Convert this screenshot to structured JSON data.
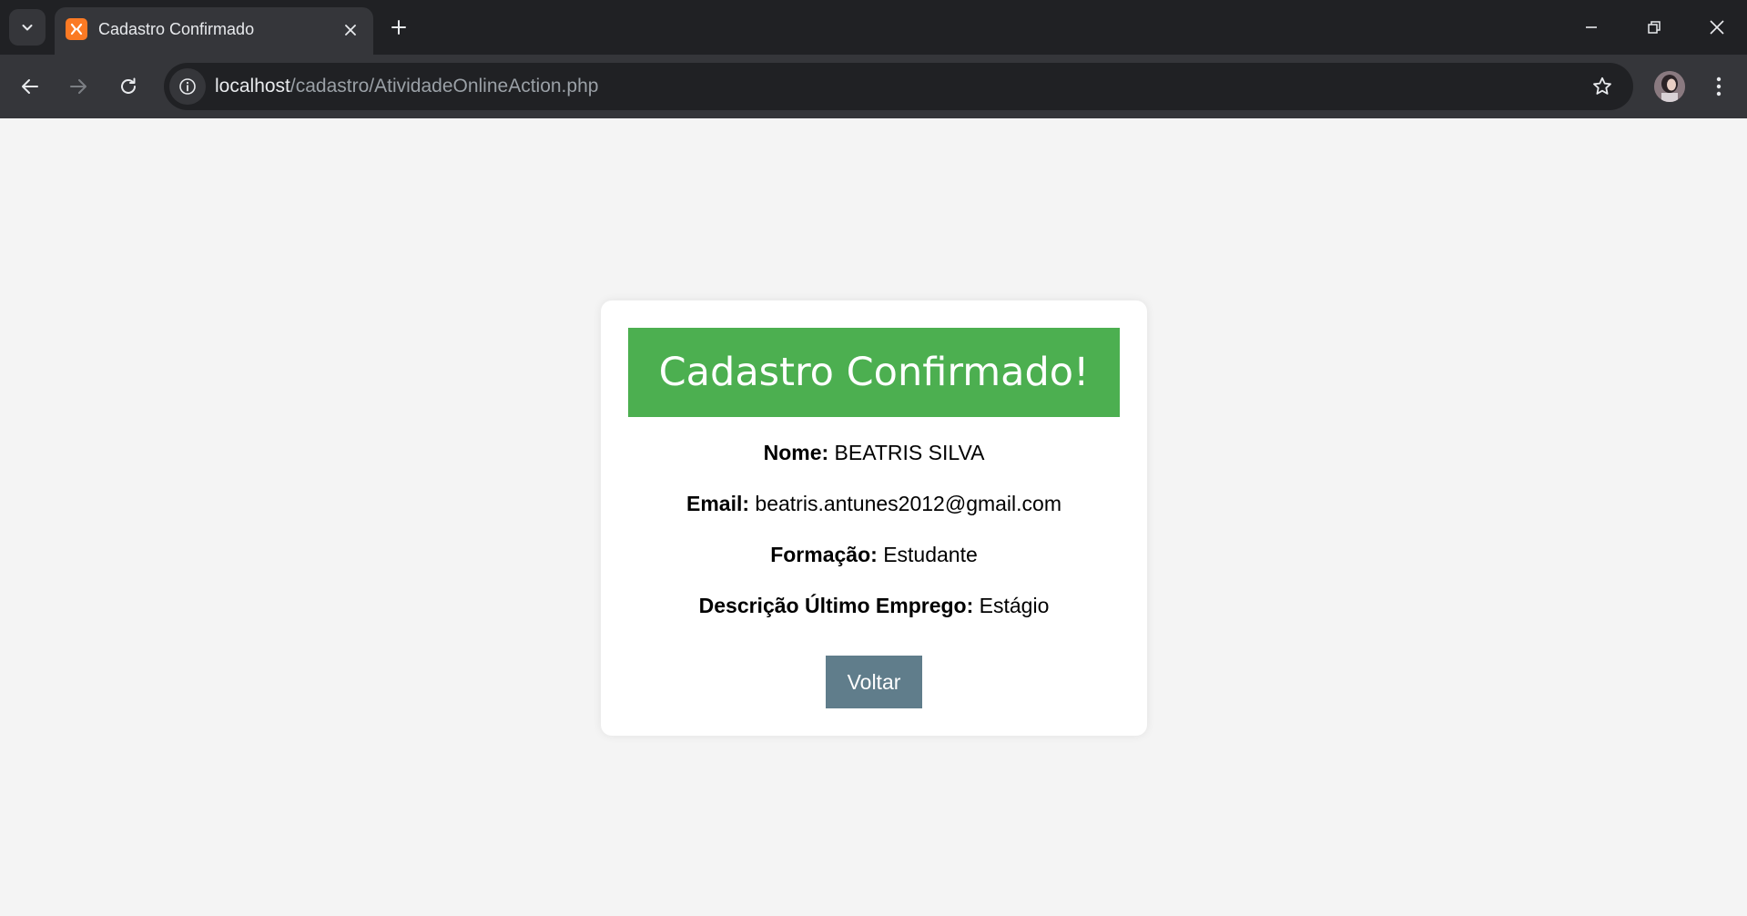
{
  "browser": {
    "tab_title": "Cadastro Confirmado",
    "url_host": "localhost",
    "url_path": "/cadastro/AtividadeOnlineAction.php",
    "favicon_color": "#fb7a24"
  },
  "page": {
    "heading": "Cadastro Confirmado!",
    "fields": [
      {
        "label": "Nome:",
        "value": "BEATRIS SILVA"
      },
      {
        "label": "Email:",
        "value": "beatris.antunes2012@gmail.com"
      },
      {
        "label": "Formação:",
        "value": "Estudante"
      },
      {
        "label": "Descrição Último Emprego:",
        "value": "Estágio"
      }
    ],
    "back_button": "Voltar"
  },
  "colors": {
    "banner": "#4caf50",
    "button": "#607d8b",
    "page_bg": "#f4f4f4",
    "card_bg": "#ffffff"
  }
}
